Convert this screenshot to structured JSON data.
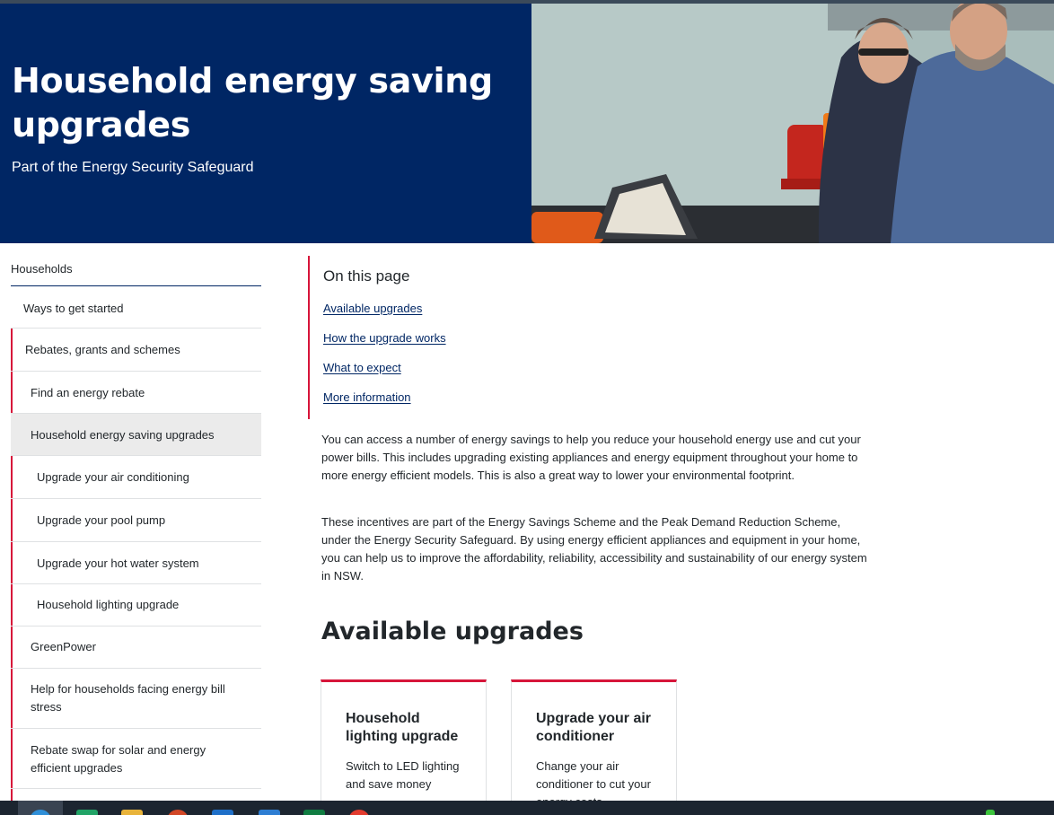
{
  "hero": {
    "title": "Household energy saving upgrades",
    "subtitle": "Part of the Energy Security Safeguard"
  },
  "sidebar": {
    "heading": "Households",
    "items": [
      {
        "label": "Ways to get started"
      },
      {
        "label": "Rebates, grants and schemes"
      },
      {
        "label": "Find an energy rebate"
      },
      {
        "label": "Household energy saving upgrades"
      },
      {
        "label": "Upgrade your air conditioning"
      },
      {
        "label": "Upgrade your pool pump"
      },
      {
        "label": "Upgrade your hot water system"
      },
      {
        "label": "Household lighting upgrade"
      },
      {
        "label": "GreenPower"
      },
      {
        "label": "Help for households facing energy bill stress"
      },
      {
        "label": "Rebate swap for solar and energy efficient upgrades"
      }
    ]
  },
  "on_this_page": {
    "title": "On this page",
    "links": [
      {
        "label": "Available upgrades"
      },
      {
        "label": "How the upgrade works"
      },
      {
        "label": "What to expect"
      },
      {
        "label": "More information"
      }
    ]
  },
  "content": {
    "para1": "You can access a number of energy savings to help you reduce your household energy use and cut your power bills. This includes upgrading existing appliances and energy equipment throughout your home to more energy efficient models. This is also a great way to lower your environmental footprint.",
    "para2": "These incentives are part of the Energy Savings Scheme and the Peak Demand Reduction Scheme, under the Energy Security Safeguard. By using energy efficient appliances and equipment in your home, you can help us to improve the affordability, reliability, accessibility and sustainability of our energy system in NSW.",
    "section_heading": "Available upgrades",
    "cards": [
      {
        "title": "Household lighting upgrade",
        "desc": "Switch to LED lighting and save money"
      },
      {
        "title": "Upgrade your air conditioner",
        "desc": "Change your air conditioner to cut your energy costs"
      }
    ]
  },
  "colors": {
    "brand_navy": "#002664",
    "accent_red": "#d7153a"
  }
}
